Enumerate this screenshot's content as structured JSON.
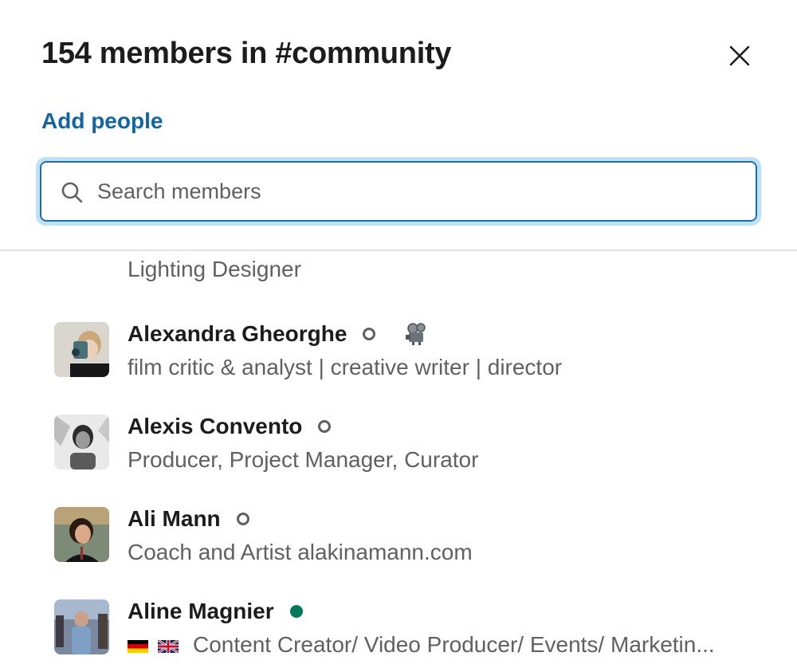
{
  "header": {
    "title": "154 members in #community",
    "add_people_label": "Add people"
  },
  "search": {
    "placeholder": "Search members",
    "value": ""
  },
  "members": [
    {
      "name": "",
      "title": "Lighting Designer",
      "presence": "none"
    },
    {
      "name": "Alexandra Gheorghe",
      "title": "film critic & analyst | creative writer | director",
      "presence": "away",
      "status_emoji": "film-projector-icon"
    },
    {
      "name": "Alexis Convento",
      "title": "Producer, Project Manager, Curator",
      "presence": "away"
    },
    {
      "name": "Ali Mann",
      "title": "Coach and Artist alakinamann.com",
      "presence": "away"
    },
    {
      "name": "Aline Magnier",
      "title": "Content Creator/ Video Producer/ Events/ Marketin...",
      "presence": "active",
      "flags": [
        "germany-flag-icon",
        "uk-flag-icon"
      ]
    }
  ],
  "colors": {
    "link": "#1264a3",
    "focus_ring": "#bfe1f4",
    "search_border": "#1d6ea8",
    "active_presence": "#007a5a",
    "secondary_text": "#616061"
  }
}
